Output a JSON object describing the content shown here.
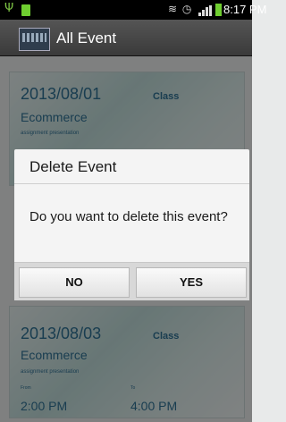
{
  "status_bar": {
    "time": "8:17 PM",
    "icons": [
      "usb-icon",
      "battery-small-icon",
      "vibrate-icon",
      "alarm-icon",
      "signal-icon",
      "battery-icon"
    ],
    "battery_color": "#6fce30"
  },
  "header": {
    "title": "All Event",
    "icon": "calendar-grid-icon"
  },
  "events": [
    {
      "date": "2013/08/01",
      "category": "Class",
      "name": "Ecommerce",
      "description": "assignment presentation"
    },
    {
      "date": "2013/08/03",
      "category": "Class",
      "name": "Ecommerce",
      "description": "assignment presentation",
      "from_label": "From",
      "to_label": "To",
      "from_time": "2:00 PM",
      "to_time": "4:00 PM"
    }
  ],
  "dialog": {
    "title": "Delete Event",
    "message": "Do you want to delete this event?",
    "no_label": "NO",
    "yes_label": "YES"
  },
  "colors": {
    "accent_text": "#2f6f92",
    "title_bar": "#3f3f3f",
    "overlay": "rgba(0,0,0,0.45)"
  }
}
